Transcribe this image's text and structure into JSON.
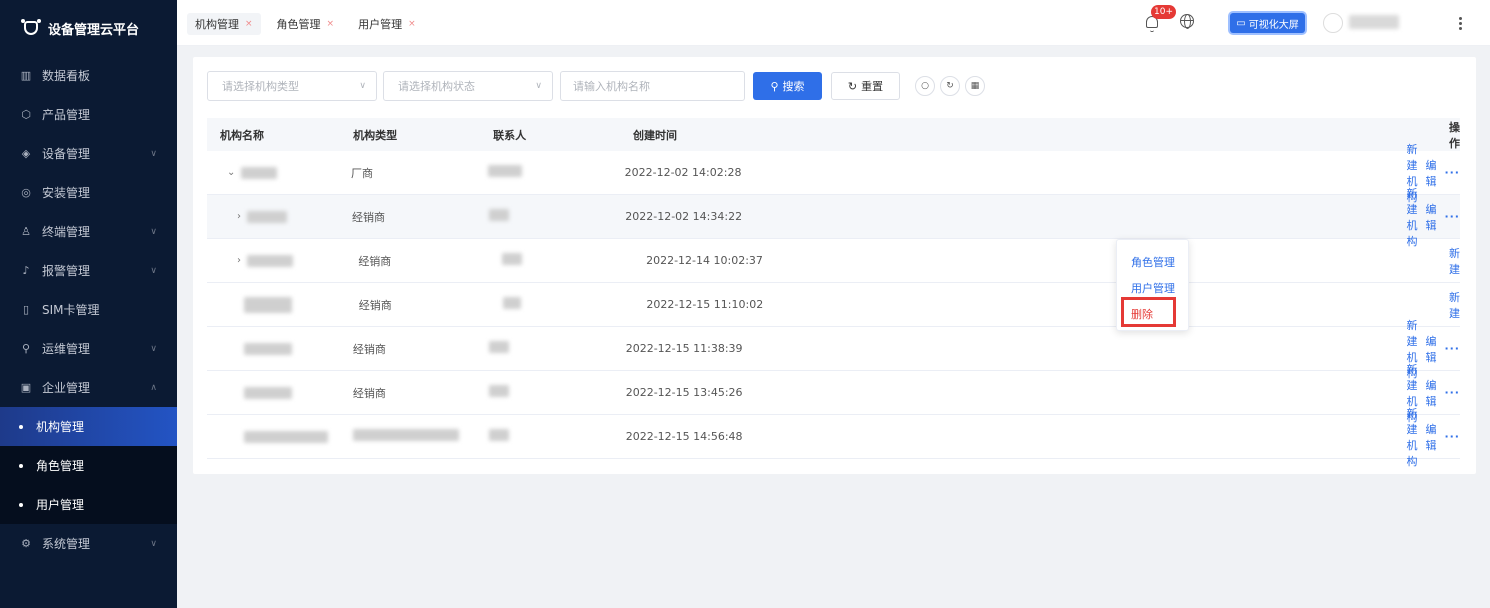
{
  "app": {
    "title": "设备管理云平台"
  },
  "sidebar": {
    "items": [
      {
        "label": "数据看板",
        "icon": "bar-chart-icon",
        "arrow": false
      },
      {
        "label": "产品管理",
        "icon": "cube-icon",
        "arrow": false
      },
      {
        "label": "设备管理",
        "icon": "layers-icon",
        "arrow": true
      },
      {
        "label": "安装管理",
        "icon": "compass-icon",
        "arrow": false
      },
      {
        "label": "终端管理",
        "icon": "user-icon",
        "arrow": true
      },
      {
        "label": "报警管理",
        "icon": "alarm-icon",
        "arrow": true
      },
      {
        "label": "SIM卡管理",
        "icon": "sim-icon",
        "arrow": false
      },
      {
        "label": "运维管理",
        "icon": "tool-icon",
        "arrow": true
      },
      {
        "label": "企业管理",
        "icon": "building-icon",
        "arrow": true,
        "expanded": true
      }
    ],
    "sub_items": [
      {
        "label": "机构管理",
        "active": true
      },
      {
        "label": "角色管理",
        "active": false
      },
      {
        "label": "用户管理",
        "active": false
      }
    ],
    "last_item": {
      "label": "系统管理",
      "icon": "settings-icon",
      "arrow": true
    }
  },
  "topbar": {
    "tabs": [
      {
        "label": "机构管理",
        "active": true
      },
      {
        "label": "角色管理",
        "active": false
      },
      {
        "label": "用户管理",
        "active": false
      }
    ],
    "tab_close_symbol": "×",
    "notification_badge": "10+",
    "bigscreen_label": "可视化大屏"
  },
  "filters": {
    "org_type_placeholder": "请选择机构类型",
    "org_status_placeholder": "请选择机构状态",
    "org_name_placeholder": "请输入机构名称",
    "search_label": "搜索",
    "reset_label": "重置"
  },
  "table": {
    "headers": {
      "name": "机构名称",
      "type": "机构类型",
      "contact": "联系人",
      "created": "创建时间",
      "ops": "操作"
    },
    "rows": [
      {
        "type": "厂商",
        "created": "2022-12-02 14:02:28",
        "expand": "⌄"
      },
      {
        "type": "经销商",
        "created": "2022-12-02 14:34:22",
        "expand": "›"
      },
      {
        "type": "经销商",
        "created": "2022-12-14 10:02:37",
        "expand": "›"
      },
      {
        "type": "经销商",
        "created": "2022-12-15 11:10:02",
        "expand": ""
      },
      {
        "type": "经销商",
        "created": "2022-12-15 11:38:39",
        "expand": ""
      },
      {
        "type": "经销商",
        "created": "2022-12-15 13:45:26",
        "expand": ""
      },
      {
        "type": "",
        "created": "2022-12-15 14:56:48",
        "expand": ""
      }
    ],
    "ops": {
      "new_org": "新建机构",
      "new_org_truncated": "新建",
      "edit": "编辑",
      "more": "···"
    }
  },
  "dropdown": {
    "items": [
      "角色管理",
      "用户管理",
      "删除"
    ]
  },
  "colors": {
    "primary": "#2f6fe8",
    "sidebar_bg": "#0b1a33",
    "danger": "#e53935"
  }
}
